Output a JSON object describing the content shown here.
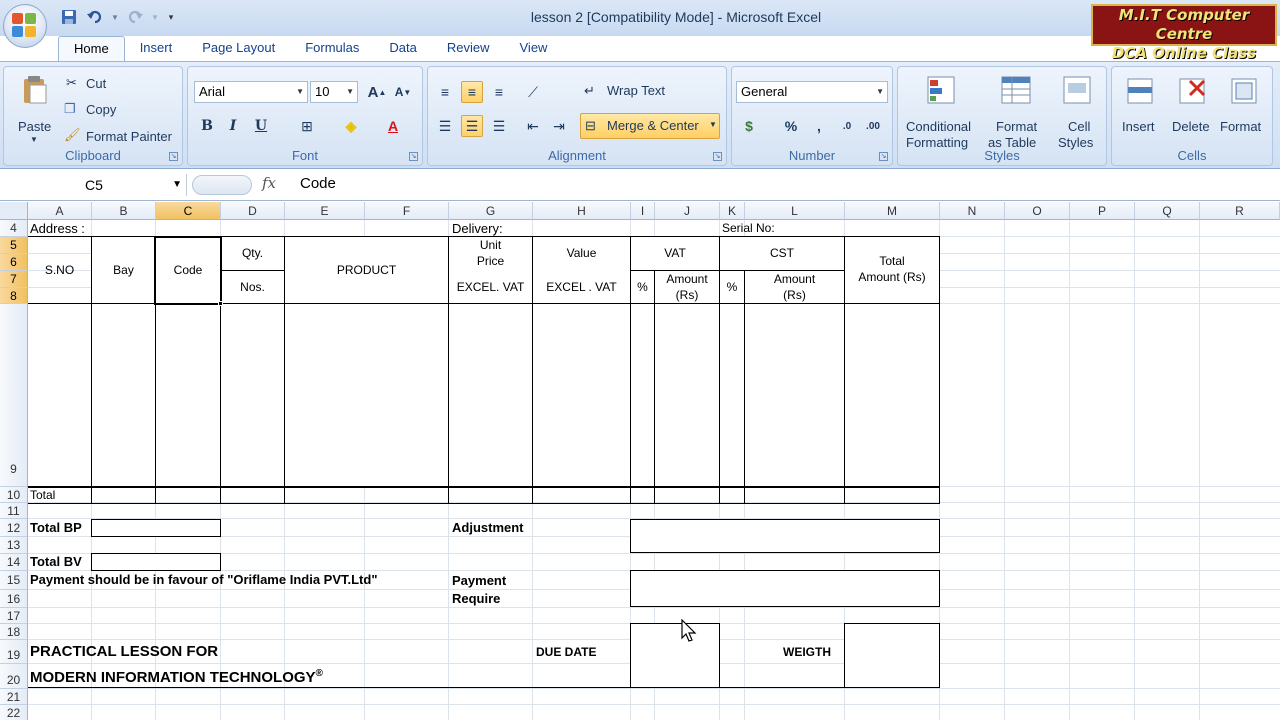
{
  "window": {
    "title": "lesson 2  [Compatibility Mode] - Microsoft Excel"
  },
  "brand": {
    "line1": "M.I.T Computer Centre",
    "line2": "DCA Online Class"
  },
  "tabs": [
    "Home",
    "Insert",
    "Page Layout",
    "Formulas",
    "Data",
    "Review",
    "View"
  ],
  "ribbon": {
    "clipboard": {
      "label": "Clipboard",
      "paste": "Paste",
      "cut": "Cut",
      "copy": "Copy",
      "format_painter": "Format Painter"
    },
    "font": {
      "label": "Font",
      "name": "Arial",
      "size": "10"
    },
    "alignment": {
      "label": "Alignment",
      "wrap": "Wrap Text",
      "merge": "Merge & Center"
    },
    "number": {
      "label": "Number",
      "format": "General",
      "percent": "%",
      "comma": ","
    },
    "styles": {
      "label": "Styles",
      "conditional_1": "Conditional",
      "conditional_2": "Formatting",
      "format_table_1": "Format",
      "format_table_2": "as Table",
      "cell_styles_1": "Cell",
      "cell_styles_2": "Styles"
    },
    "cells": {
      "label": "Cells",
      "insert": "Insert",
      "delete": "Delete",
      "format": "Format"
    }
  },
  "formula_bar": {
    "name_box": "C5",
    "fx": "fx",
    "content": "Code"
  },
  "columns": [
    "A",
    "B",
    "C",
    "D",
    "E",
    "F",
    "G",
    "H",
    "I",
    "J",
    "K",
    "L",
    "M",
    "N",
    "O",
    "P",
    "Q",
    "R"
  ],
  "rows": [
    "4",
    "5",
    "6",
    "7",
    "8",
    "9",
    "10",
    "11",
    "12",
    "13",
    "14",
    "15",
    "16",
    "17",
    "18",
    "19",
    "20",
    "21",
    "22"
  ],
  "cells": {
    "address": "Address :",
    "delivery": "Delivery:",
    "serial": "Serial No:",
    "sno": "S.NO",
    "bay": "Bay",
    "code": "Code",
    "qty": "Qty.",
    "nos": "Nos.",
    "product": "PRODUCT",
    "unit_price_1": "Unit",
    "unit_price_2": "Price",
    "excel_vat_1": "EXCEL. VAT",
    "value": "Value",
    "excel_vat_2": "EXCEL . VAT",
    "vat": "VAT",
    "vat_pct": "%",
    "vat_amount_1": "Amount",
    "vat_amount_2": "(Rs)",
    "cst": "CST",
    "cst_pct": "%",
    "cst_amount_1": "Amount",
    "cst_amount_2": "(Rs)",
    "total_amount_1": "Total",
    "total_amount_2": "Amount (Rs)",
    "total": "Total",
    "total_bp": "Total BP",
    "total_bv": "Total BV",
    "adjustment": "Adjustment",
    "payment_note": "Payment should be in favour of \"Oriflame India PVT.Ltd\"",
    "payment_1": "Payment",
    "payment_2": "Require",
    "lesson_1": "PRACTICAL LESSON FOR",
    "lesson_2": "MODERN INFORMATION TECHNOLOGY",
    "registered": "®",
    "due_date": "DUE  DATE",
    "weight": "WEIGTH"
  }
}
